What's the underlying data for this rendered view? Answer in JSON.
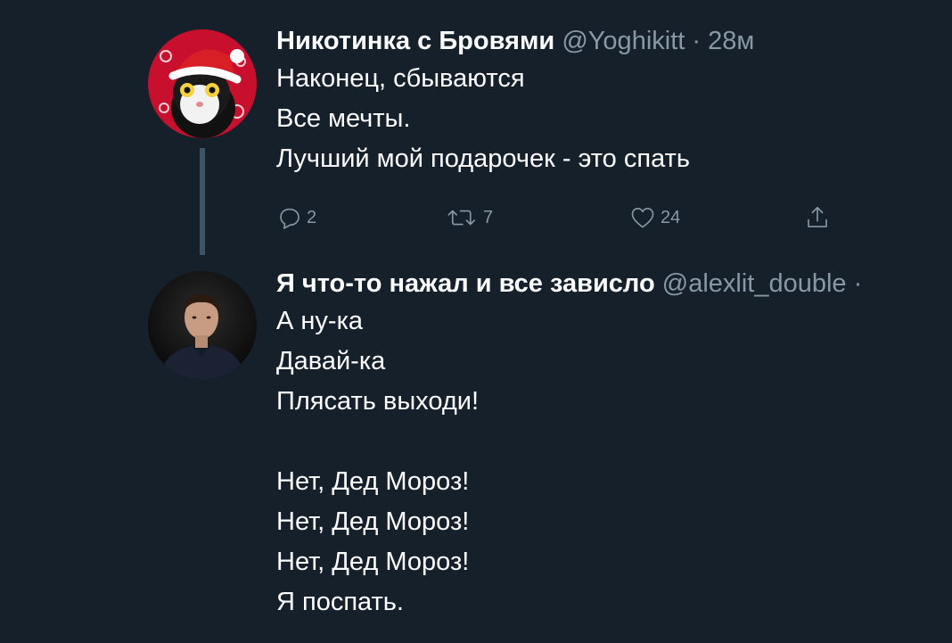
{
  "thread": [
    {
      "name": "Никотинка с Бровями",
      "handle": "@Yoghikitt",
      "separator": "·",
      "time": "28м",
      "lines": [
        "Наконец, сбываются",
        "Все мечты.",
        "Лучший мой подарочек - это спать"
      ],
      "actions": {
        "replies": "2",
        "retweets": "7",
        "likes": "24"
      }
    },
    {
      "name": "Я что-то нажал и все зависло",
      "handle": "@alexlit_double",
      "separator": "·",
      "lines": [
        "А ну-ка",
        "Давай-ка",
        "Плясать выходи!",
        "",
        "Нет, Дед Мороз!",
        "Нет, Дед Мороз!",
        "Нет, Дед Мороз!",
        "Я поспать."
      ]
    }
  ],
  "icons": {
    "reply": "reply-icon",
    "retweet": "retweet-icon",
    "like": "heart-icon",
    "share": "share-icon"
  },
  "colors": {
    "background": "#15202b",
    "text": "#ffffff",
    "secondary": "#8899a6",
    "thread_line": "#3d5466"
  }
}
